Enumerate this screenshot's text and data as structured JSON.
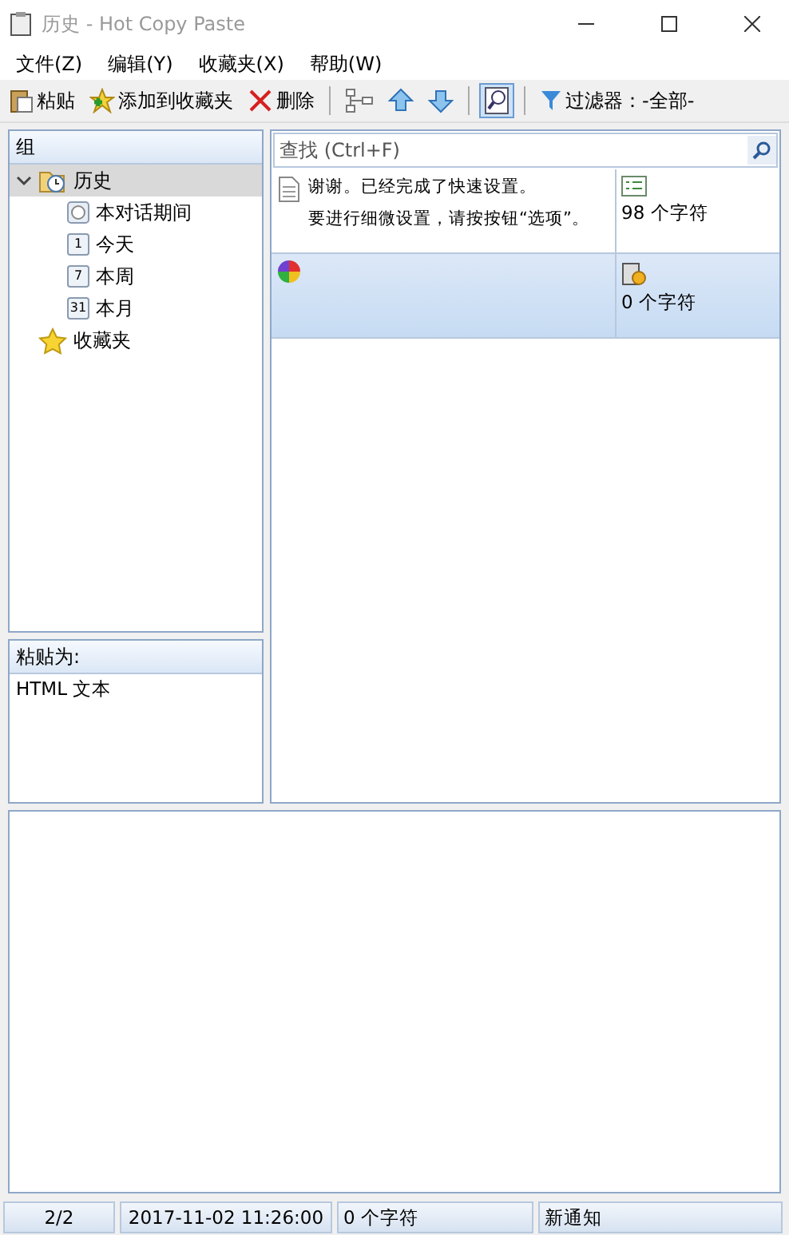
{
  "window": {
    "title": "历史 - Hot Copy Paste"
  },
  "menu": [
    "文件(Z)",
    "编辑(Y)",
    "收藏夹(X)",
    "帮助(W)"
  ],
  "toolbar": [
    {
      "kind": "paste",
      "label": "粘贴",
      "on": false
    },
    {
      "kind": "favorite",
      "label": "添加到收藏夹",
      "on": false
    },
    {
      "kind": "delete",
      "label": "删除",
      "on": false
    },
    {
      "kind": "sep"
    },
    {
      "kind": "tree",
      "on": false
    },
    {
      "kind": "up",
      "on": false
    },
    {
      "kind": "down",
      "on": false
    },
    {
      "kind": "sep"
    },
    {
      "kind": "search",
      "on": true
    },
    {
      "kind": "sep"
    },
    {
      "kind": "filter",
      "label": "过滤器：-全部-",
      "on": false
    }
  ],
  "groups": {
    "header": "组",
    "items": [
      {
        "label": "历史",
        "kind": "history",
        "expanded": true,
        "selected": true,
        "children": [
          {
            "label": "本对话期间",
            "kind": "session",
            "selected": false
          },
          {
            "label": "今天",
            "kind": "day",
            "badge": "1",
            "selected": false
          },
          {
            "label": "本周",
            "kind": "day",
            "badge": "7",
            "selected": false
          },
          {
            "label": "本月",
            "kind": "day",
            "badge": "31",
            "selected": false
          }
        ]
      },
      {
        "label": "收藏夹",
        "kind": "star",
        "selected": false
      }
    ]
  },
  "paste_as": {
    "header": "粘贴为:",
    "value": "HTML 文本"
  },
  "search": {
    "placeholder": "查找 (Ctrl+F)"
  },
  "clips": [
    {
      "kind": "text",
      "lines": [
        "谢谢。已经完成了快速设置。",
        "要进行细微设置，请按按钮“选项”。"
      ],
      "size": "98 个字符",
      "selected": false
    },
    {
      "kind": "color",
      "size": "0 个字符",
      "selected": true
    }
  ],
  "status_bar": [
    "2/2",
    "2017-11-02 11:26:00",
    "0 个字符",
    "新通知"
  ]
}
